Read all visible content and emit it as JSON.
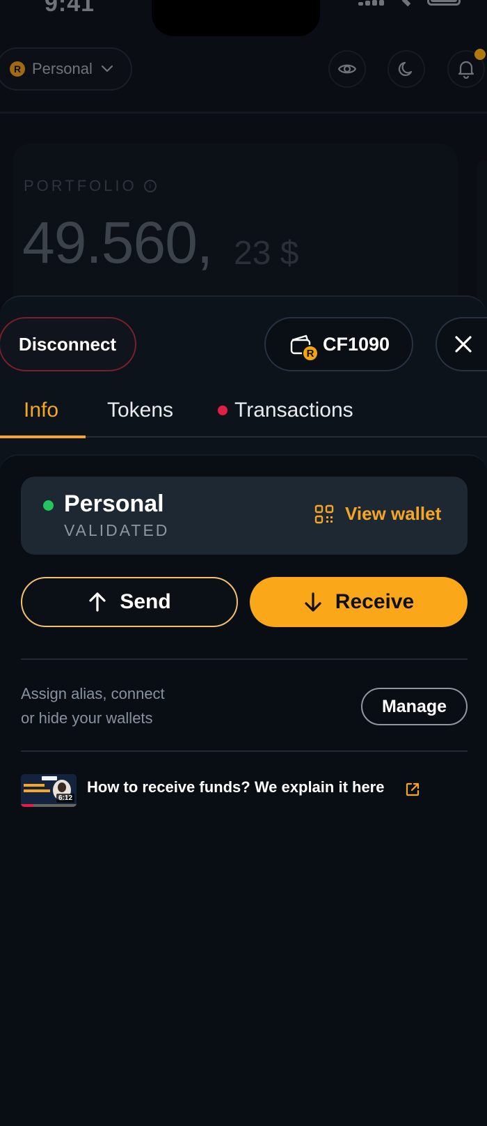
{
  "status_bar": {
    "time": "9:41"
  },
  "account": {
    "coin_letter": "R",
    "name": "Personal"
  },
  "portfolio": {
    "label": "PORTFOLIO",
    "amount": "49.560,",
    "decimals": "23 $"
  },
  "sheet": {
    "disconnect_label": "Disconnect",
    "wallet_code": "CF1090",
    "wallet_badge": "R"
  },
  "tabs": [
    {
      "label": "Info",
      "active": true
    },
    {
      "label": "Tokens",
      "active": false
    },
    {
      "label": "Transactions",
      "active": false,
      "has_dot": true
    }
  ],
  "wallet_card": {
    "name": "Personal",
    "status": "VALIDATED",
    "view_label": "View wallet"
  },
  "actions": {
    "send_label": "Send",
    "receive_label": "Receive"
  },
  "manage_section": {
    "description_line1": "Assign alias, connect",
    "description_line2": "or hide your wallets",
    "manage_label": "Manage"
  },
  "video_link": {
    "text": "How to receive funds? We explain it here",
    "duration": "6:12"
  },
  "colors": {
    "accent": "#f5a623",
    "receive_button": "#fba71a",
    "validated_dot": "#22c55e",
    "notification_dot": "#e11d48"
  }
}
